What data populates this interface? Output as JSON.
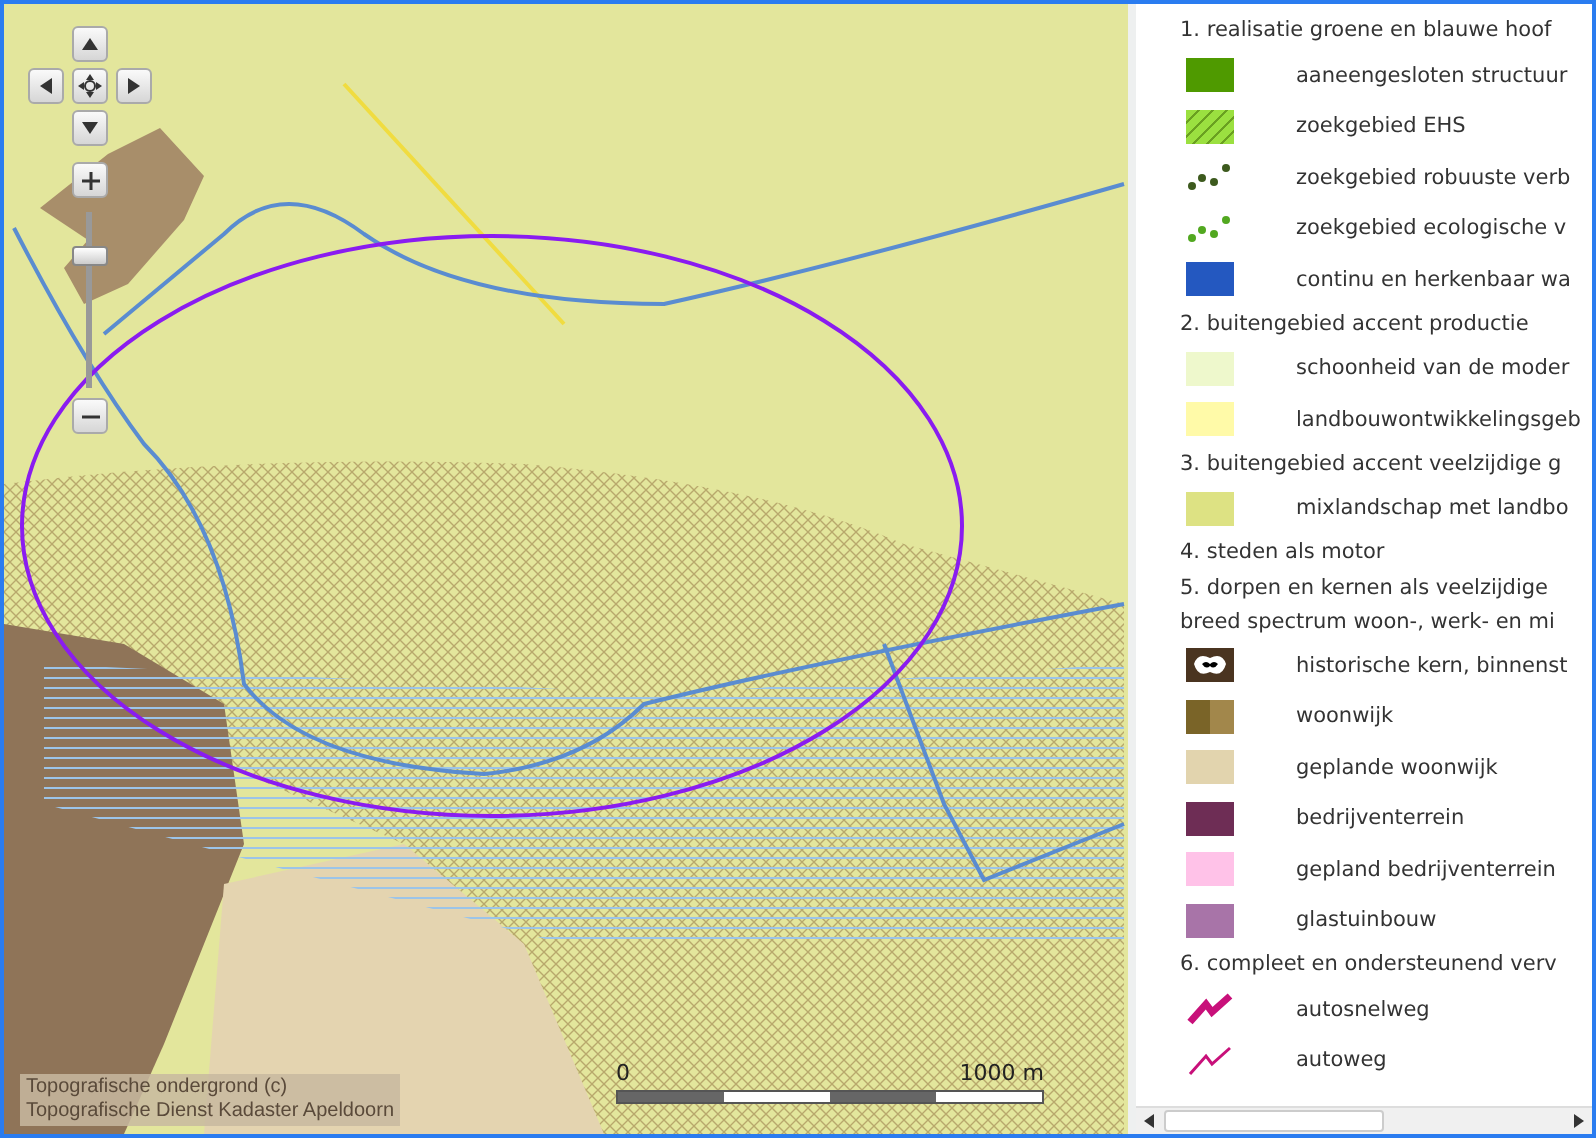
{
  "map": {
    "scale_bar": {
      "start": "0",
      "end": "1000 m"
    },
    "attribution": [
      "Topografische ondergrond (c)",
      "Topografische Dienst Kadaster Apeldoorn"
    ]
  },
  "legend": {
    "items": [
      {
        "kind": "heading",
        "label": "1. realisatie groene en blauwe hoof"
      },
      {
        "kind": "fill",
        "color": "#4f9a00",
        "label": "aaneengesloten structuur"
      },
      {
        "kind": "hatch",
        "color": "#9be040",
        "label": "zoekgebied EHS"
      },
      {
        "kind": "dots",
        "color": "#3d5a1e",
        "label": "zoekgebied robuuste verb"
      },
      {
        "kind": "dots",
        "color": "#52a820",
        "label": "zoekgebied ecologische v"
      },
      {
        "kind": "fill",
        "color": "#2458c0",
        "label": "continu en herkenbaar wa"
      },
      {
        "kind": "heading",
        "label": "2. buitengebied accent productie"
      },
      {
        "kind": "fill",
        "color": "#eef8cc",
        "label": "schoonheid van de moder"
      },
      {
        "kind": "fill",
        "color": "#fffaa8",
        "label": "landbouwontwikkelingsgeb"
      },
      {
        "kind": "heading",
        "label": "3. buitengebied accent veelzijdige g"
      },
      {
        "kind": "fill",
        "color": "#dde283",
        "label": "mixlandschap met landbo"
      },
      {
        "kind": "heading",
        "label": "4. steden als motor"
      },
      {
        "kind": "heading",
        "label": "5. dorpen en kernen als veelzijdige"
      },
      {
        "kind": "heading",
        "label": "breed spectrum woon-, werk- en mi"
      },
      {
        "kind": "pattern",
        "color": "#4a3420",
        "label": "historische kern, binnenst"
      },
      {
        "kind": "split",
        "color": "#7a6428",
        "label": "woonwijk"
      },
      {
        "kind": "fill",
        "color": "#e2d4ae",
        "label": "geplande woonwijk"
      },
      {
        "kind": "fill",
        "color": "#6e2d55",
        "label": "bedrijventerrein"
      },
      {
        "kind": "fill",
        "color": "#ffc2e8",
        "label": "gepland bedrijventerrein"
      },
      {
        "kind": "fill",
        "color": "#a874a8",
        "label": "glastuinbouw"
      },
      {
        "kind": "heading",
        "label": "6. compleet en ondersteunend verv"
      },
      {
        "kind": "road-major",
        "color": "#c8107a",
        "label": "autosnelweg"
      },
      {
        "kind": "road",
        "color": "#c8107a",
        "label": "autoweg"
      }
    ]
  }
}
